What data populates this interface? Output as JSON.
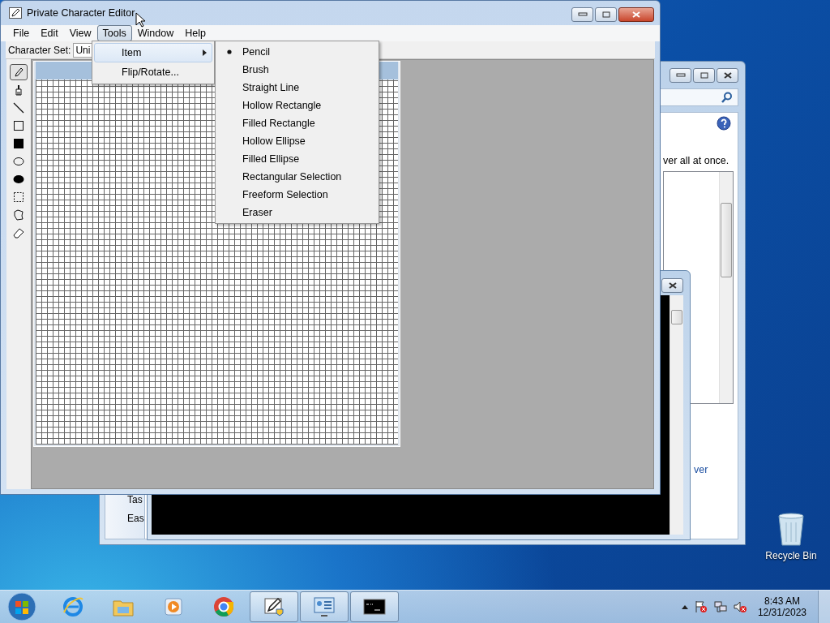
{
  "window": {
    "title": "Private Character Editor",
    "menu": [
      {
        "label": "File",
        "selected": false
      },
      {
        "label": "Edit",
        "selected": false
      },
      {
        "label": "View",
        "selected": false
      },
      {
        "label": "Tools",
        "selected": true
      },
      {
        "label": "Window",
        "selected": false
      },
      {
        "label": "Help",
        "selected": false
      }
    ],
    "character_set": {
      "label": "Character Set:",
      "value": "Uni"
    },
    "tools": [
      {
        "kind": "pencil",
        "selected": true
      },
      {
        "kind": "brush",
        "selected": false
      },
      {
        "kind": "line",
        "selected": false
      },
      {
        "kind": "hollow-rect",
        "selected": false
      },
      {
        "kind": "filled-rect",
        "selected": false
      },
      {
        "kind": "hollow-ellipse",
        "selected": false
      },
      {
        "kind": "filled-ellipse",
        "selected": false
      },
      {
        "kind": "rect-select",
        "selected": false
      },
      {
        "kind": "freeform-select",
        "selected": false
      },
      {
        "kind": "eraser",
        "selected": false
      }
    ]
  },
  "tools_menu": [
    {
      "label": "Item",
      "submenu": true,
      "selected": true
    },
    {
      "label": "Flip/Rotate...",
      "submenu": false,
      "selected": false
    }
  ],
  "item_submenu": [
    {
      "label": "Pencil",
      "checked": true
    },
    {
      "label": "Brush",
      "checked": false
    },
    {
      "label": "Straight Line",
      "checked": false
    },
    {
      "label": "Hollow Rectangle",
      "checked": false
    },
    {
      "label": "Filled Rectangle",
      "checked": false
    },
    {
      "label": "Hollow Ellipse",
      "checked": false
    },
    {
      "label": "Filled Ellipse",
      "checked": false
    },
    {
      "label": "Rectangular Selection",
      "checked": false
    },
    {
      "label": "Freeform Selection",
      "checked": false
    },
    {
      "label": "Eraser",
      "checked": false
    }
  ],
  "back_window": {
    "text": "ver all at once.",
    "link": "ver",
    "side_items": [
      "Tas",
      "Eas"
    ]
  },
  "desktop_icons": [
    {
      "label": "Recycle Bin"
    }
  ],
  "taskbar": {
    "apps": [
      {
        "kind": "ie",
        "active": false
      },
      {
        "kind": "folder",
        "active": false
      },
      {
        "kind": "media",
        "active": false
      },
      {
        "kind": "chrome",
        "active": false
      },
      {
        "kind": "editor",
        "active": true
      },
      {
        "kind": "control-panel",
        "active": true
      },
      {
        "kind": "console",
        "active": true
      }
    ],
    "clock": {
      "time": "8:43 AM",
      "date": "12/31/2023"
    }
  }
}
